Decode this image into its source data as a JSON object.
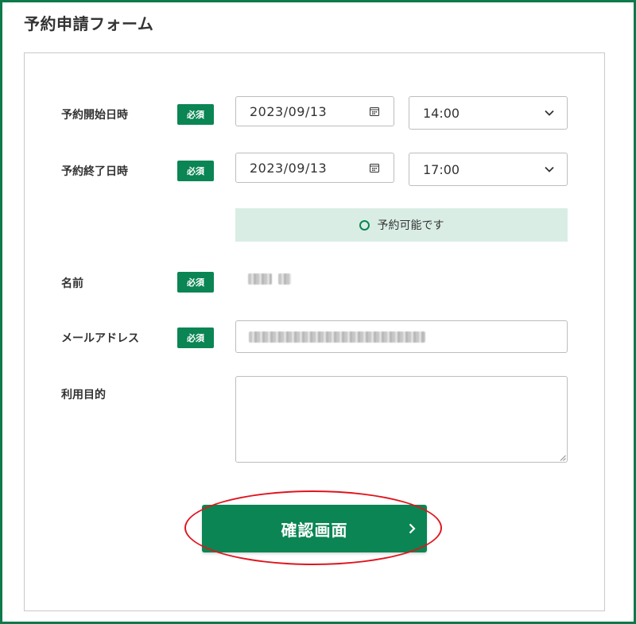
{
  "form": {
    "title": "予約申請フォーム",
    "required_badge": "必須",
    "start": {
      "label": "予約開始日時",
      "date": "2023/09/13",
      "time": "14:00"
    },
    "end": {
      "label": "予約終了日時",
      "date": "2023/09/13",
      "time": "17:00"
    },
    "availability": "予約可能です",
    "name": {
      "label": "名前"
    },
    "email": {
      "label": "メールアドレス"
    },
    "purpose": {
      "label": "利用目的",
      "value": ""
    },
    "confirm_button": "確認画面"
  },
  "colors": {
    "brand_green": "#0a8553",
    "availability_bg": "#d9ede5",
    "annotation_red": "#e0141e"
  },
  "icons": {
    "date_picker": "calendar-icon",
    "select": "chevron-down-icon",
    "availability": "circle-icon",
    "button": "chevron-right-icon"
  }
}
